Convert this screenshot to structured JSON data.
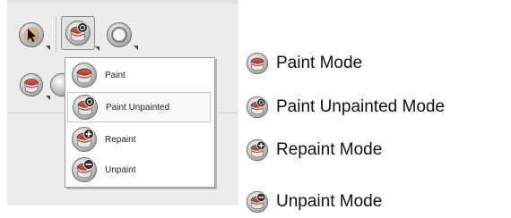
{
  "menu": {
    "items": [
      {
        "label": "Paint",
        "icon": "paint-mode-icon"
      },
      {
        "label": "Paint Unpainted",
        "icon": "paint-unpainted-mode-icon"
      },
      {
        "label": "Repaint",
        "icon": "repaint-mode-icon"
      },
      {
        "label": "Unpaint",
        "icon": "unpaint-mode-icon"
      }
    ]
  },
  "legend": {
    "items": [
      {
        "label": "Paint Mode",
        "icon": "paint-mode-icon"
      },
      {
        "label": "Paint Unpainted Mode",
        "icon": "paint-unpainted-mode-icon"
      },
      {
        "label": "Repaint Mode",
        "icon": "repaint-mode-icon"
      },
      {
        "label": "Unpaint Mode",
        "icon": "unpaint-mode-icon"
      }
    ]
  },
  "toolbar": {
    "buttons": [
      "select-arrow-icon",
      "paint-unpainted-mode-icon",
      "ring-icon",
      "paint-bucket-icon",
      "round-icon"
    ]
  },
  "colors": {
    "bucket_red": "#b8402c",
    "bucket_grey": "#d2d2d2",
    "badge_dark": "#3a3a3a",
    "background": "#ececec"
  }
}
